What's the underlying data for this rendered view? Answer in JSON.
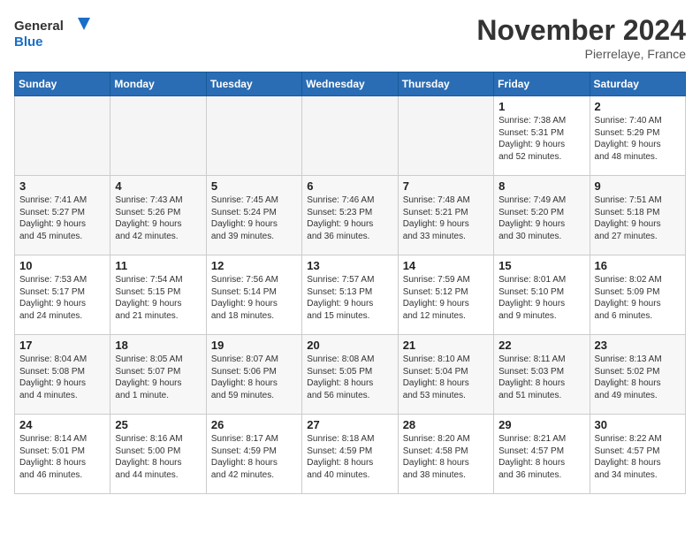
{
  "header": {
    "logo_line1": "General",
    "logo_line2": "Blue",
    "month": "November 2024",
    "location": "Pierrelaye, France"
  },
  "days_of_week": [
    "Sunday",
    "Monday",
    "Tuesday",
    "Wednesday",
    "Thursday",
    "Friday",
    "Saturday"
  ],
  "weeks": [
    [
      {
        "num": "",
        "text": ""
      },
      {
        "num": "",
        "text": ""
      },
      {
        "num": "",
        "text": ""
      },
      {
        "num": "",
        "text": ""
      },
      {
        "num": "",
        "text": ""
      },
      {
        "num": "1",
        "text": "Sunrise: 7:38 AM\nSunset: 5:31 PM\nDaylight: 9 hours\nand 52 minutes."
      },
      {
        "num": "2",
        "text": "Sunrise: 7:40 AM\nSunset: 5:29 PM\nDaylight: 9 hours\nand 48 minutes."
      }
    ],
    [
      {
        "num": "3",
        "text": "Sunrise: 7:41 AM\nSunset: 5:27 PM\nDaylight: 9 hours\nand 45 minutes."
      },
      {
        "num": "4",
        "text": "Sunrise: 7:43 AM\nSunset: 5:26 PM\nDaylight: 9 hours\nand 42 minutes."
      },
      {
        "num": "5",
        "text": "Sunrise: 7:45 AM\nSunset: 5:24 PM\nDaylight: 9 hours\nand 39 minutes."
      },
      {
        "num": "6",
        "text": "Sunrise: 7:46 AM\nSunset: 5:23 PM\nDaylight: 9 hours\nand 36 minutes."
      },
      {
        "num": "7",
        "text": "Sunrise: 7:48 AM\nSunset: 5:21 PM\nDaylight: 9 hours\nand 33 minutes."
      },
      {
        "num": "8",
        "text": "Sunrise: 7:49 AM\nSunset: 5:20 PM\nDaylight: 9 hours\nand 30 minutes."
      },
      {
        "num": "9",
        "text": "Sunrise: 7:51 AM\nSunset: 5:18 PM\nDaylight: 9 hours\nand 27 minutes."
      }
    ],
    [
      {
        "num": "10",
        "text": "Sunrise: 7:53 AM\nSunset: 5:17 PM\nDaylight: 9 hours\nand 24 minutes."
      },
      {
        "num": "11",
        "text": "Sunrise: 7:54 AM\nSunset: 5:15 PM\nDaylight: 9 hours\nand 21 minutes."
      },
      {
        "num": "12",
        "text": "Sunrise: 7:56 AM\nSunset: 5:14 PM\nDaylight: 9 hours\nand 18 minutes."
      },
      {
        "num": "13",
        "text": "Sunrise: 7:57 AM\nSunset: 5:13 PM\nDaylight: 9 hours\nand 15 minutes."
      },
      {
        "num": "14",
        "text": "Sunrise: 7:59 AM\nSunset: 5:12 PM\nDaylight: 9 hours\nand 12 minutes."
      },
      {
        "num": "15",
        "text": "Sunrise: 8:01 AM\nSunset: 5:10 PM\nDaylight: 9 hours\nand 9 minutes."
      },
      {
        "num": "16",
        "text": "Sunrise: 8:02 AM\nSunset: 5:09 PM\nDaylight: 9 hours\nand 6 minutes."
      }
    ],
    [
      {
        "num": "17",
        "text": "Sunrise: 8:04 AM\nSunset: 5:08 PM\nDaylight: 9 hours\nand 4 minutes."
      },
      {
        "num": "18",
        "text": "Sunrise: 8:05 AM\nSunset: 5:07 PM\nDaylight: 9 hours\nand 1 minute."
      },
      {
        "num": "19",
        "text": "Sunrise: 8:07 AM\nSunset: 5:06 PM\nDaylight: 8 hours\nand 59 minutes."
      },
      {
        "num": "20",
        "text": "Sunrise: 8:08 AM\nSunset: 5:05 PM\nDaylight: 8 hours\nand 56 minutes."
      },
      {
        "num": "21",
        "text": "Sunrise: 8:10 AM\nSunset: 5:04 PM\nDaylight: 8 hours\nand 53 minutes."
      },
      {
        "num": "22",
        "text": "Sunrise: 8:11 AM\nSunset: 5:03 PM\nDaylight: 8 hours\nand 51 minutes."
      },
      {
        "num": "23",
        "text": "Sunrise: 8:13 AM\nSunset: 5:02 PM\nDaylight: 8 hours\nand 49 minutes."
      }
    ],
    [
      {
        "num": "24",
        "text": "Sunrise: 8:14 AM\nSunset: 5:01 PM\nDaylight: 8 hours\nand 46 minutes."
      },
      {
        "num": "25",
        "text": "Sunrise: 8:16 AM\nSunset: 5:00 PM\nDaylight: 8 hours\nand 44 minutes."
      },
      {
        "num": "26",
        "text": "Sunrise: 8:17 AM\nSunset: 4:59 PM\nDaylight: 8 hours\nand 42 minutes."
      },
      {
        "num": "27",
        "text": "Sunrise: 8:18 AM\nSunset: 4:59 PM\nDaylight: 8 hours\nand 40 minutes."
      },
      {
        "num": "28",
        "text": "Sunrise: 8:20 AM\nSunset: 4:58 PM\nDaylight: 8 hours\nand 38 minutes."
      },
      {
        "num": "29",
        "text": "Sunrise: 8:21 AM\nSunset: 4:57 PM\nDaylight: 8 hours\nand 36 minutes."
      },
      {
        "num": "30",
        "text": "Sunrise: 8:22 AM\nSunset: 4:57 PM\nDaylight: 8 hours\nand 34 minutes."
      }
    ]
  ]
}
